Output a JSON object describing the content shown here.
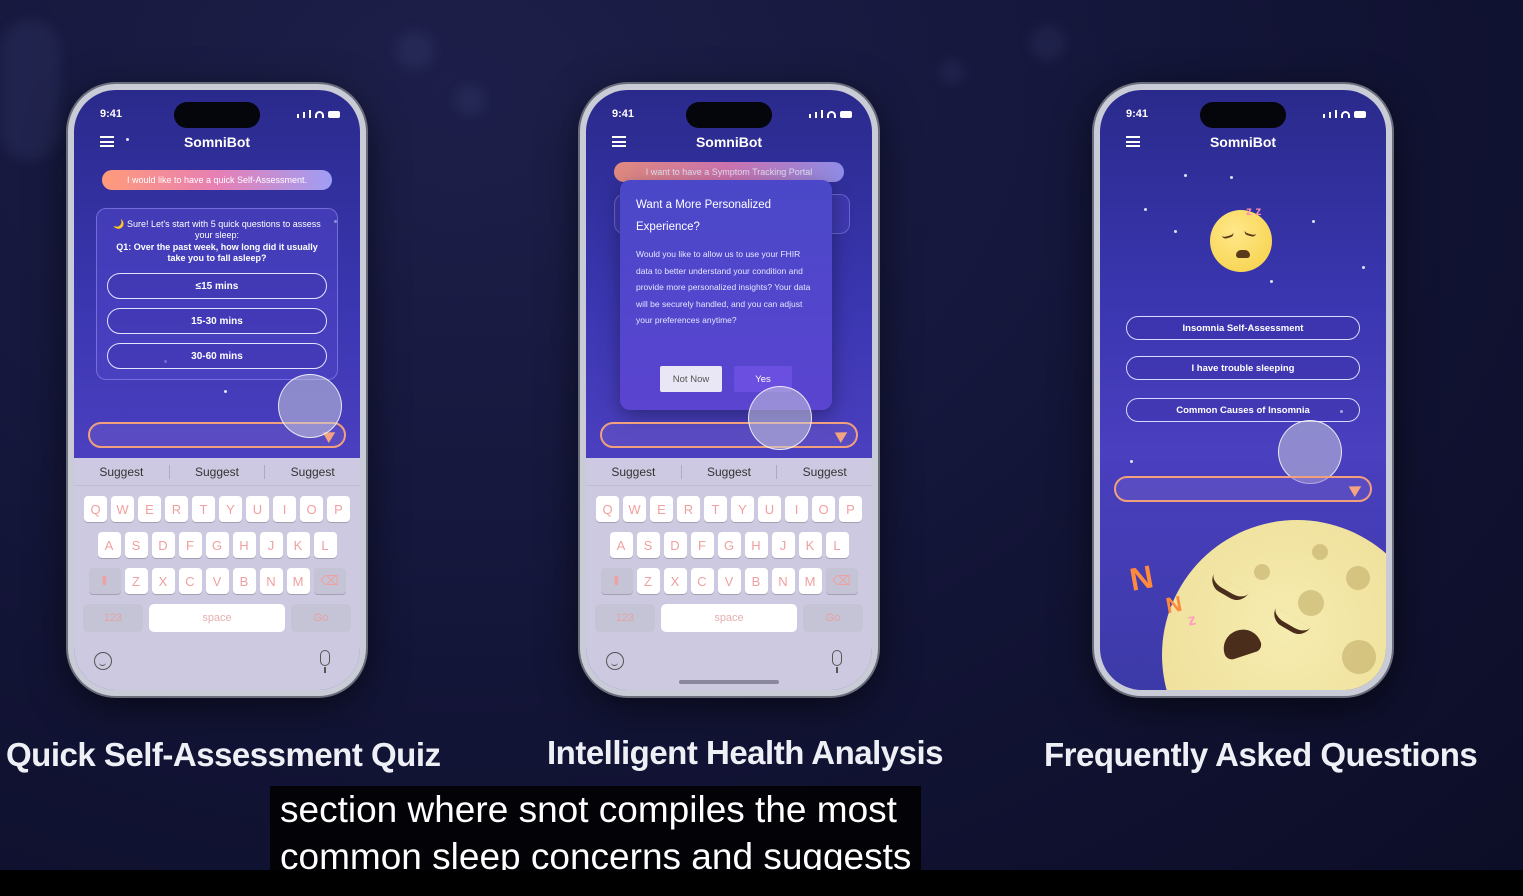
{
  "phones": [
    {
      "status_time": "9:41",
      "app_title": "SomniBot",
      "user_message": "I would like to have a quick Self-Assessment.",
      "bot_intro": "🌙 Sure! Let's start with 5 quick questions to assess your sleep:",
      "bot_question": "Q1: Over the past week, how long did it usually take you to fall asleep?",
      "options": [
        "≤15 mins",
        "15-30 mins",
        "30-60 mins"
      ],
      "suggestions": [
        "Suggest",
        "Suggest",
        "Suggest"
      ],
      "caption": "Quick Self-Assessment Quiz"
    },
    {
      "status_time": "9:41",
      "app_title": "SomniBot",
      "user_message": "I want to have a Symptom Tracking Portal",
      "dialog_title": "Want a More Personalized Experience?",
      "dialog_body": "Would you like to allow us to use your FHIR data to better understand your condition and provide more personalized insights? Your data will be securely handled, and you can adjust your preferences anytime?",
      "dialog_cancel": "Not Now",
      "dialog_confirm": "Yes",
      "suggestions": [
        "Suggest",
        "Suggest",
        "Suggest"
      ],
      "caption": "Intelligent Health Analysis"
    },
    {
      "status_time": "9:41",
      "app_title": "SomniBot",
      "faq_items": [
        "Insomnia Self-Assessment",
        "I have trouble sleeping",
        "Common Causes of Insomnia"
      ],
      "caption": "Frequently Asked Questions"
    }
  ],
  "keyboard": {
    "row1": [
      "Q",
      "W",
      "E",
      "R",
      "T",
      "Y",
      "U",
      "I",
      "O",
      "P"
    ],
    "row2": [
      "A",
      "S",
      "D",
      "F",
      "G",
      "H",
      "J",
      "K",
      "L"
    ],
    "row3": [
      "Z",
      "X",
      "C",
      "V",
      "B",
      "N",
      "M"
    ],
    "numbers_key": "123",
    "space_key": "space",
    "go_key": "Go"
  },
  "subtitle": "section where snot compiles the most\ncommon sleep concerns and suggests",
  "icons": [
    "menu-icon",
    "send-icon",
    "emoji-icon",
    "mic-icon",
    "shift-icon",
    "backspace-icon",
    "sleeping-moon-icon"
  ]
}
